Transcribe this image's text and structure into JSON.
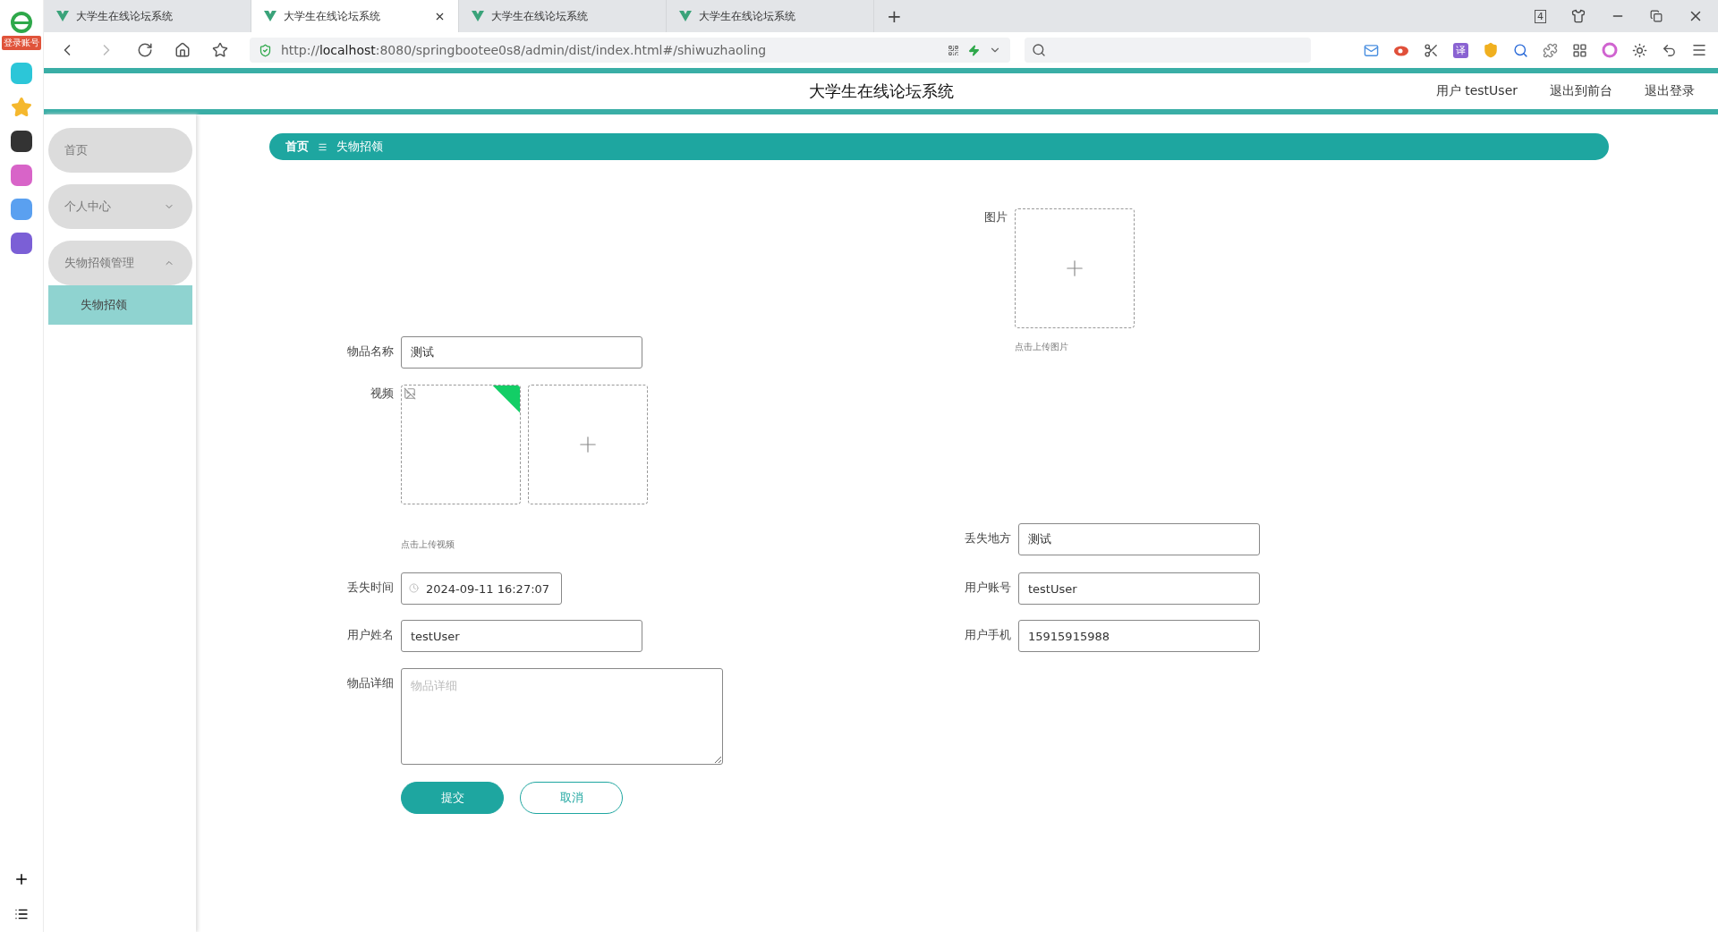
{
  "browser": {
    "badge": "登录账号",
    "tabs": [
      {
        "title": "大学生在线论坛系统",
        "selected": false
      },
      {
        "title": "大学生在线论坛系统",
        "selected": true
      },
      {
        "title": "大学生在线论坛系统",
        "selected": false
      },
      {
        "title": "大学生在线论坛系统",
        "selected": false
      }
    ],
    "new_tab": "+",
    "tab_count": "4",
    "url": "http://**localhost**:8080/springbootee0s8/admin/dist/index.html#/shiwuzhaoling",
    "translate_label": "译"
  },
  "header": {
    "title": "大学生在线论坛系统",
    "links": [
      "用户 testUser",
      "退出到前台",
      "退出登录"
    ]
  },
  "sidebar": {
    "items": [
      {
        "label": "首页",
        "kind": "link",
        "selected": false
      },
      {
        "label": "个人中心",
        "kind": "submenu",
        "selected": false,
        "expanded": false
      },
      {
        "label": "失物招领管理",
        "kind": "submenu",
        "selected": false,
        "expanded": true,
        "children": [
          {
            "label": "失物招领",
            "selected": true
          }
        ]
      }
    ]
  },
  "breadcrumb": [
    "首页",
    "失物招领"
  ],
  "form": {
    "fields": [
      {
        "label": "图片",
        "kind": "image_upload",
        "hint": "点击上传图片"
      },
      {
        "label": "物品名称",
        "kind": "text",
        "value": "测试"
      },
      {
        "label": "视频",
        "kind": "video_upload",
        "hint": "点击上传视频"
      },
      {
        "label": "丢失地方",
        "kind": "text",
        "value": "测试"
      },
      {
        "label": "丢失时间",
        "kind": "datetime",
        "value": "2024-09-11 16:27:07"
      },
      {
        "label": "用户账号",
        "kind": "text",
        "value": "testUser"
      },
      {
        "label": "用户姓名",
        "kind": "text",
        "value": "testUser"
      },
      {
        "label": "用户手机",
        "kind": "text",
        "value": "15915915988"
      },
      {
        "label": "物品详细",
        "kind": "textarea",
        "placeholder": "物品详细"
      }
    ],
    "buttons": [
      {
        "label": "提交",
        "kind": "primary"
      },
      {
        "label": "取消",
        "kind": "plain"
      }
    ]
  }
}
